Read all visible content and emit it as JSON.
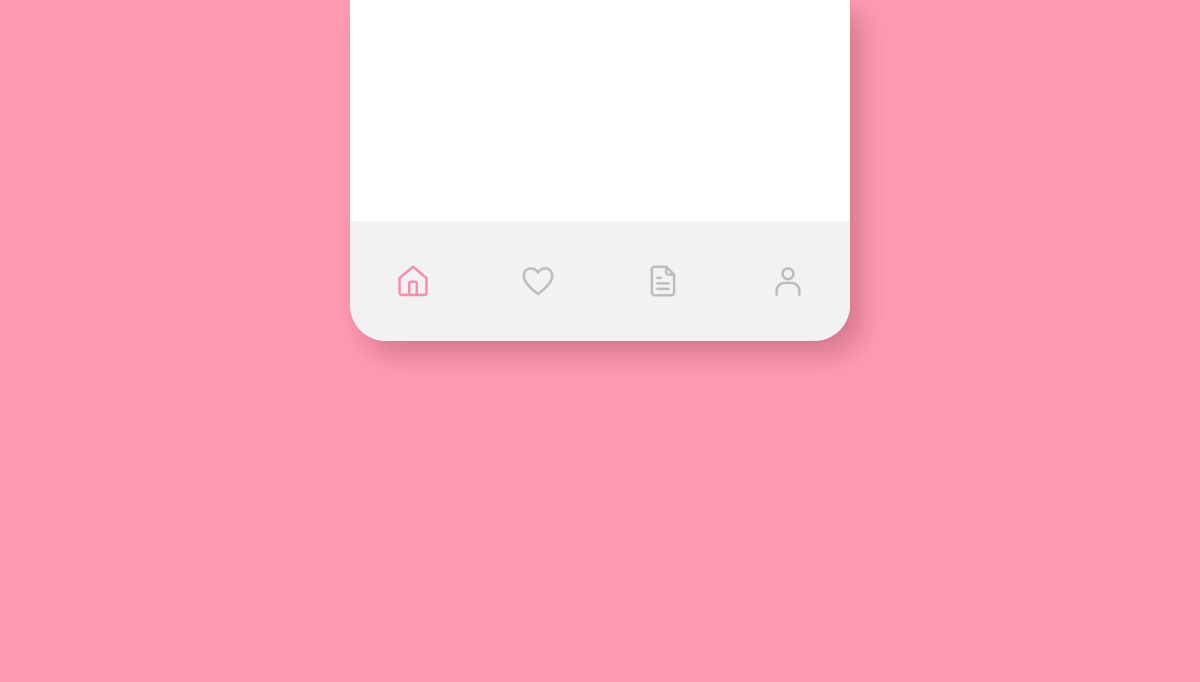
{
  "colors": {
    "background": "#ff9cb4",
    "card": "#ffffff",
    "nav_bar": "#f2f2f2",
    "active_icon": "#f58fab",
    "inactive_icon": "#bdbdbd"
  },
  "bottom_nav": {
    "items": [
      {
        "id": "home",
        "icon": "home-icon",
        "active": true
      },
      {
        "id": "favorites",
        "icon": "heart-icon",
        "active": false
      },
      {
        "id": "documents",
        "icon": "document-icon",
        "active": false
      },
      {
        "id": "profile",
        "icon": "user-icon",
        "active": false
      }
    ]
  }
}
